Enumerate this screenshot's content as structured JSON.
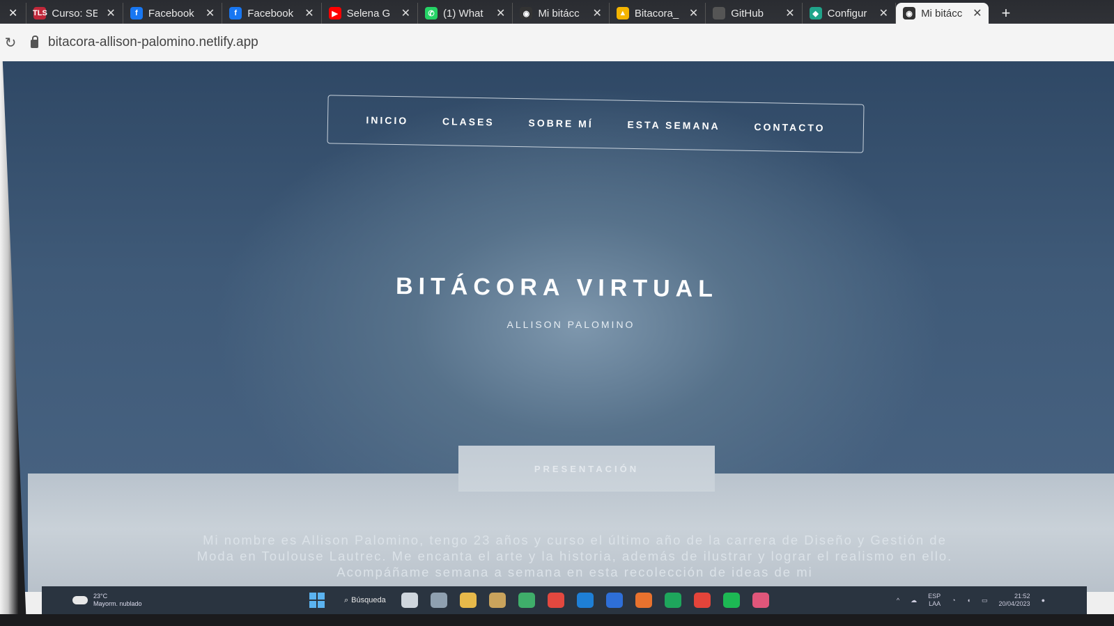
{
  "browser": {
    "tabs": [
      {
        "title": "Curso: SE",
        "icon": "tls-icon",
        "color": "#c0283a",
        "badge": "TLS",
        "width": 66
      },
      {
        "title": "Facebook",
        "icon": "facebook-icon",
        "color": "#1877f2",
        "badge": "f",
        "width": 70
      },
      {
        "title": "Facebook",
        "icon": "facebook-icon",
        "color": "#1877f2",
        "badge": "f",
        "width": 70
      },
      {
        "title": "Selena G",
        "icon": "youtube-icon",
        "color": "#ff0000",
        "badge": "▶",
        "width": 66
      },
      {
        "title": "(1) What",
        "icon": "whatsapp-icon",
        "color": "#25d366",
        "badge": "✆",
        "width": 64
      },
      {
        "title": "Mi bitácc",
        "icon": "globe-icon",
        "color": "#333333",
        "badge": "◉",
        "width": 66
      },
      {
        "title": "Bitacora_",
        "icon": "google-drive-icon",
        "color": "#f4b400",
        "badge": "▲",
        "width": 66
      },
      {
        "title": "GitHub",
        "icon": "github-icon",
        "color": "#555555",
        "badge": "",
        "width": 66
      },
      {
        "title": "Configur",
        "icon": "netlify-icon",
        "color": "#20a48a",
        "badge": "◆",
        "width": 62
      },
      {
        "title": "Mi bitácc",
        "icon": "globe-icon",
        "color": "#333333",
        "badge": "◉",
        "width": 62,
        "active": true
      }
    ],
    "url": "bitacora-allison-palomino.netlify.app",
    "new_tab": "+",
    "close": "✕"
  },
  "site": {
    "nav": [
      "INICIO",
      "CLASES",
      "SOBRE MÍ",
      "ESTA SEMANA",
      "CONTACTO"
    ],
    "title": "BITÁCORA VIRTUAL",
    "subtitle": "ALLISON PALOMINO",
    "section_tab": "PRESENTACIÓN",
    "intro": "Mi nombre es Allison Palomino, tengo 23 años y curso el último año de la carrera de Diseño y Gestión de Moda en Toulouse Lautrec. Me encanta el arte y la historia, además de ilustrar y lograr el realismo en ello. Acompáñame semana a semana en esta recolección de ideas de mi"
  },
  "taskbar": {
    "weather_temp": "23°C",
    "weather_desc": "Mayorm. nublado",
    "search_label": "Búsqueda",
    "lang_top": "ESP",
    "lang_bottom": "LAA",
    "time": "21:52",
    "date": "20/04/2023",
    "icon_colors": [
      "#cfd6dd",
      "#8fa0b0",
      "#e7b94a",
      "#c9a35c",
      "#3fae6a",
      "#e2483f",
      "#1e7fd6",
      "#2e6fd8",
      "#e8722e",
      "#1ea65c",
      "#e4443a",
      "#1db954",
      "#e0567a"
    ]
  }
}
